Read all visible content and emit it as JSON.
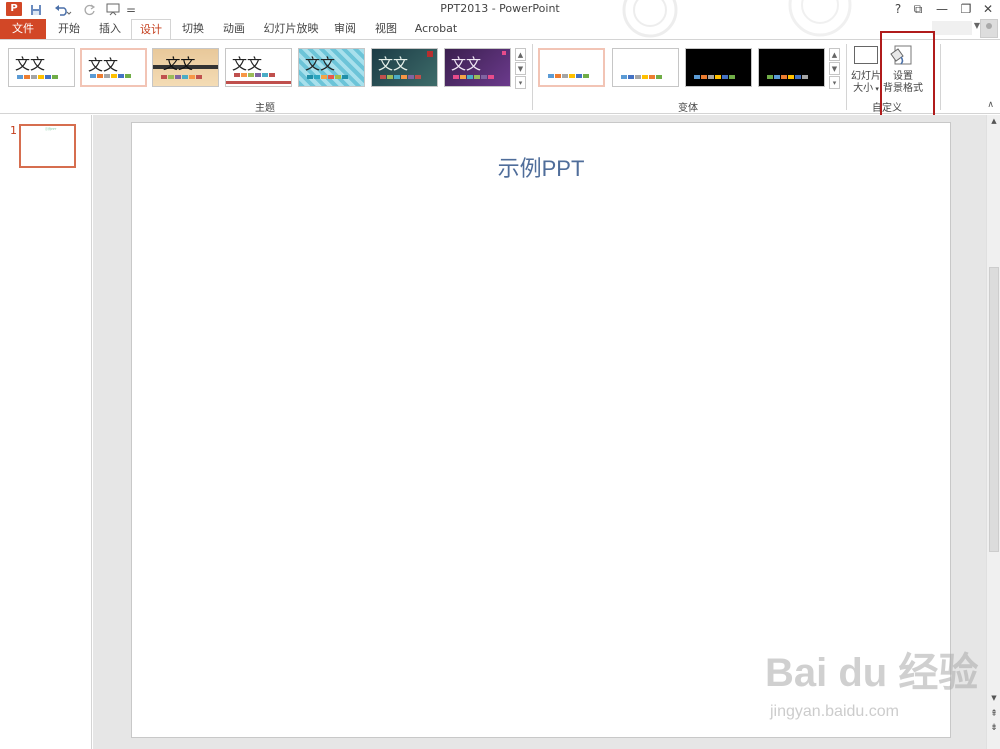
{
  "titlebar": {
    "app_title": "PPT2013 - PowerPoint",
    "app_logo": "P",
    "qat": {
      "save_icon": "save-icon",
      "undo_icon": "undo-icon",
      "redo_icon": "repeat-icon",
      "extra_icon": "slideshow-icon",
      "customize": "="
    },
    "window": {
      "help": "?",
      "restore_ribbon": "⧉",
      "minimize": "—",
      "maximize": "❐",
      "close": "✕"
    }
  },
  "tabs": [
    "文件",
    "开始",
    "插入",
    "设计",
    "切换",
    "动画",
    "幻灯片放映",
    "审阅",
    "视图",
    "Acrobat"
  ],
  "active_tab": "设计",
  "ribbon": {
    "themes_label": "主题",
    "theme_thumb_text": "文文",
    "variants_label": "变体",
    "customize_label": "自定义",
    "slide_size": {
      "line1": "幻灯片",
      "line2": "大小"
    },
    "format_bg": {
      "line1": "设置",
      "line2": "背景格式"
    },
    "collapse": "∧"
  },
  "slide_pane": {
    "slide_number": "1"
  },
  "slide": {
    "title": "示例PPT"
  },
  "scroll": {
    "up": "▲",
    "down": "▼",
    "prev": "⇞",
    "next": "⇟"
  },
  "watermark": {
    "logo": "Bai du 经验",
    "url": "jingyan.baidu.com"
  },
  "colors": {
    "accent": "#d24726",
    "highlight_box": "#b01b1b",
    "title_text": "#4f6d9a"
  }
}
